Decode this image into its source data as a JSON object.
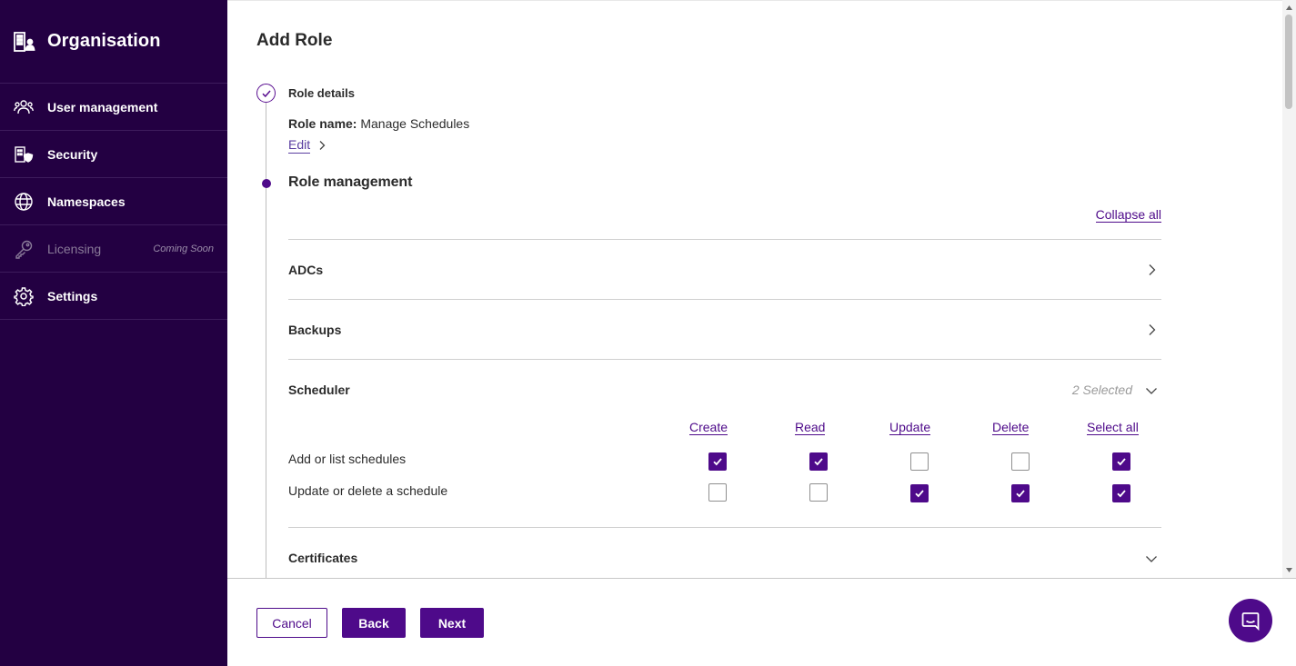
{
  "sidebar": {
    "title": "Organisation",
    "title_icon": "organisation-icon",
    "items": [
      {
        "label": "User management",
        "icon": "users-icon"
      },
      {
        "label": "Security",
        "icon": "security-icon"
      },
      {
        "label": "Namespaces",
        "icon": "globe-icon"
      },
      {
        "label": "Licensing",
        "icon": "key-icon",
        "badge": "Coming Soon",
        "disabled": true
      },
      {
        "label": "Settings",
        "icon": "gear-icon"
      }
    ]
  },
  "page": {
    "title": "Add Role"
  },
  "steps": {
    "role_details": {
      "title": "Role details",
      "role_name_label": "Role name:",
      "role_name_value": "Manage Schedules",
      "edit_label": "Edit"
    },
    "role_management": {
      "title": "Role management",
      "collapse_all_label": "Collapse all"
    }
  },
  "sections": [
    {
      "title": "ADCs",
      "expanded": false
    },
    {
      "title": "Backups",
      "expanded": false
    },
    {
      "title": "Scheduler",
      "expanded": true,
      "selected_text": "2 Selected"
    },
    {
      "title": "Certificates",
      "expanded": true
    }
  ],
  "permissions": {
    "columns": [
      "Create",
      "Read",
      "Update",
      "Delete",
      "Select all"
    ],
    "rows": [
      {
        "label": "Add or list schedules",
        "values": [
          true,
          true,
          false,
          false,
          true
        ]
      },
      {
        "label": "Update or delete a schedule",
        "values": [
          false,
          false,
          true,
          true,
          true
        ]
      }
    ]
  },
  "footer": {
    "cancel_label": "Cancel",
    "back_label": "Back",
    "next_label": "Next"
  },
  "colors": {
    "sidebar_bg": "#230042",
    "accent": "#4e0a8a"
  }
}
